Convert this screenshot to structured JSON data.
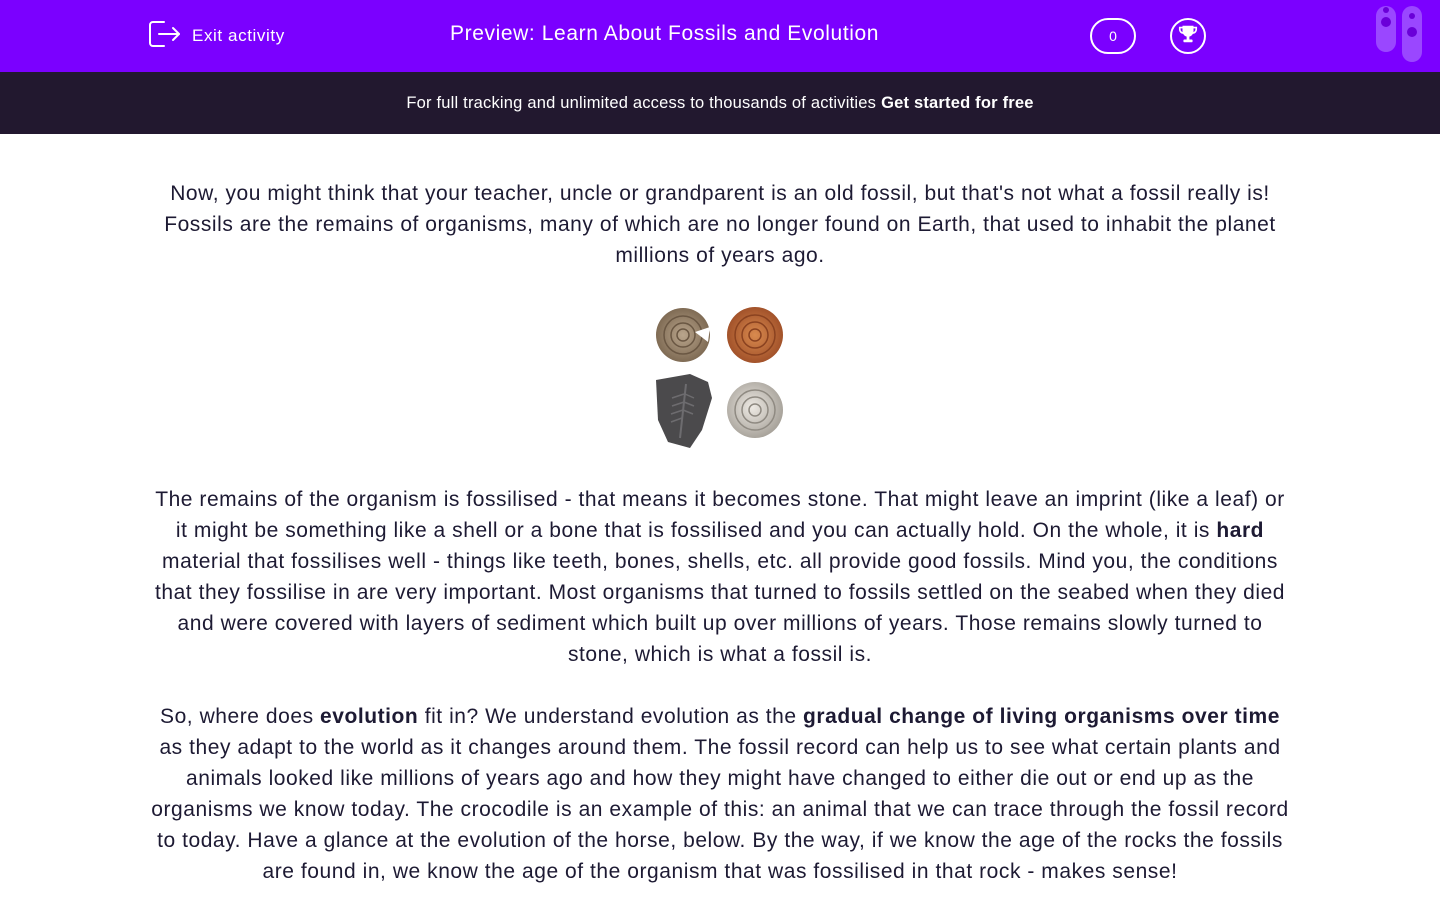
{
  "header": {
    "exit_label": "Exit activity",
    "title": "Preview: Learn About Fossils and Evolution",
    "score": "0",
    "icons": [
      "exit-icon",
      "trophy-icon",
      "brand-logo"
    ]
  },
  "promo": {
    "text": "For full tracking and unlimited access to thousands of activities",
    "link": "Get started for free"
  },
  "content": {
    "p1": "Now, you might think that your teacher, uncle or grandparent is an old fossil, but that's not what a fossil really is! Fossils are the remains of organisms, many of which are no longer found on Earth, that used to inhabit the planet millions of years ago.",
    "image_alt": "four fossils",
    "p2_a": "The remains of the organism is fossilised - that means it becomes stone. That might leave an imprint (like a leaf) or it might be something like a shell or a bone that is fossilised and you can actually hold. On the whole, it is ",
    "p2_bold": "hard",
    "p2_b": " material that fossilises well - things like teeth, bones, shells, etc. all provide good fossils. Mind you, the conditions that they fossilise in are very important. Most organisms that turned to fossils settled on the seabed when they died and were covered with layers of sediment which built up over millions of years. Those remains slowly turned to stone, which is what a fossil is.",
    "p3_a": "So, where does ",
    "p3_bold1": "evolution",
    "p3_b": " fit in? We understand evolution as the ",
    "p3_bold2": "gradual change of living organisms over time",
    "p3_c": " as they adapt to the world as it changes around them. The fossil record can help us to see what certain plants and animals looked like millions of years ago and how they might have changed to either die out or end up as the organisms we know today. The crocodile is an example of this: an animal that we can trace through the fossil record to today. Have a glance at the evolution of the horse, below. By the way, if we know the age of the rocks the fossils are found in, we know the age of the organism that was fossilised in that rock - makes sense!"
  },
  "colors": {
    "header_bg": "#7b00ff",
    "promo_bg": "#22182f",
    "text": "#1d1a33"
  }
}
